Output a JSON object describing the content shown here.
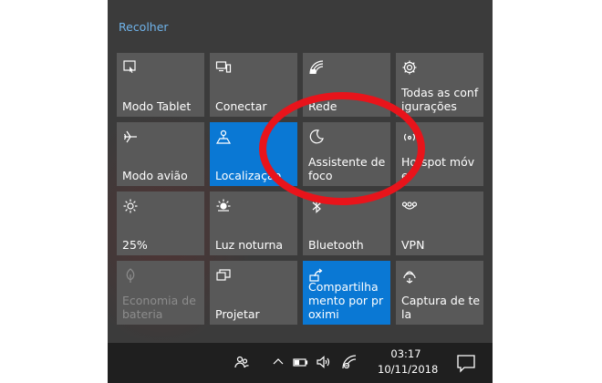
{
  "action_center": {
    "collapse_label": "Recolher",
    "tiles": [
      {
        "label": "Modo Tablet",
        "icon": "tablet-mode-icon"
      },
      {
        "label": "Conectar",
        "icon": "connect-icon"
      },
      {
        "label": "Rede",
        "icon": "network-icon"
      },
      {
        "label": "Todas as configurações",
        "icon": "gear-icon"
      },
      {
        "label": "Modo avião",
        "icon": "airplane-icon"
      },
      {
        "label": "Localização",
        "icon": "location-icon"
      },
      {
        "label": "Assistente de foco",
        "icon": "moon-icon"
      },
      {
        "label": "Hotspot móvel",
        "icon": "hotspot-icon"
      },
      {
        "label": "25%",
        "icon": "brightness-icon"
      },
      {
        "label": "Luz noturna",
        "icon": "night-light-icon"
      },
      {
        "label": "Bluetooth",
        "icon": "bluetooth-icon"
      },
      {
        "label": "VPN",
        "icon": "vpn-icon"
      },
      {
        "label": "Economia de bateria",
        "icon": "battery-saver-icon"
      },
      {
        "label": "Projetar",
        "icon": "project-icon"
      },
      {
        "label": "Compartilhamento por proximi",
        "icon": "nearby-share-icon"
      },
      {
        "label": "Captura de tela",
        "icon": "screen-snip-icon"
      }
    ]
  },
  "taskbar": {
    "time": "03:17",
    "date": "10/11/2018"
  },
  "colors": {
    "panel_bg": "#3b3b3b",
    "tile_bg": "#595959",
    "tile_active": "#0a78d4",
    "accent_link": "#6fb3ea",
    "annotation": "#e8141b"
  }
}
